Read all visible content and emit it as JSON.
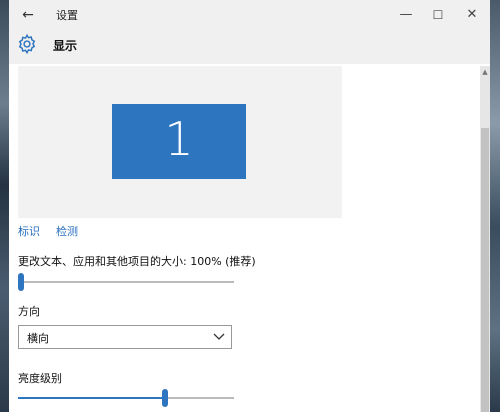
{
  "window": {
    "title": "设置",
    "back_icon": "←",
    "minimize_icon": "—",
    "maximize_icon": "☐",
    "close_icon": "✕"
  },
  "header": {
    "page_title": "显示",
    "icon": "gear-icon"
  },
  "display": {
    "monitor_number": "1",
    "monitor_color": "#2e75c0",
    "identify_link": "标识",
    "detect_link": "检测"
  },
  "scale": {
    "label": "更改文本、应用和其他项目的大小: 100% (推荐)",
    "slider_position": 0.0
  },
  "orientation": {
    "label": "方向",
    "selected": "横向"
  },
  "brightness": {
    "label": "亮度级别",
    "slider_position": 0.68
  },
  "colors": {
    "accent": "#2e75c0",
    "link": "#2a6fc0",
    "titlebar": "#f0f0f0"
  }
}
